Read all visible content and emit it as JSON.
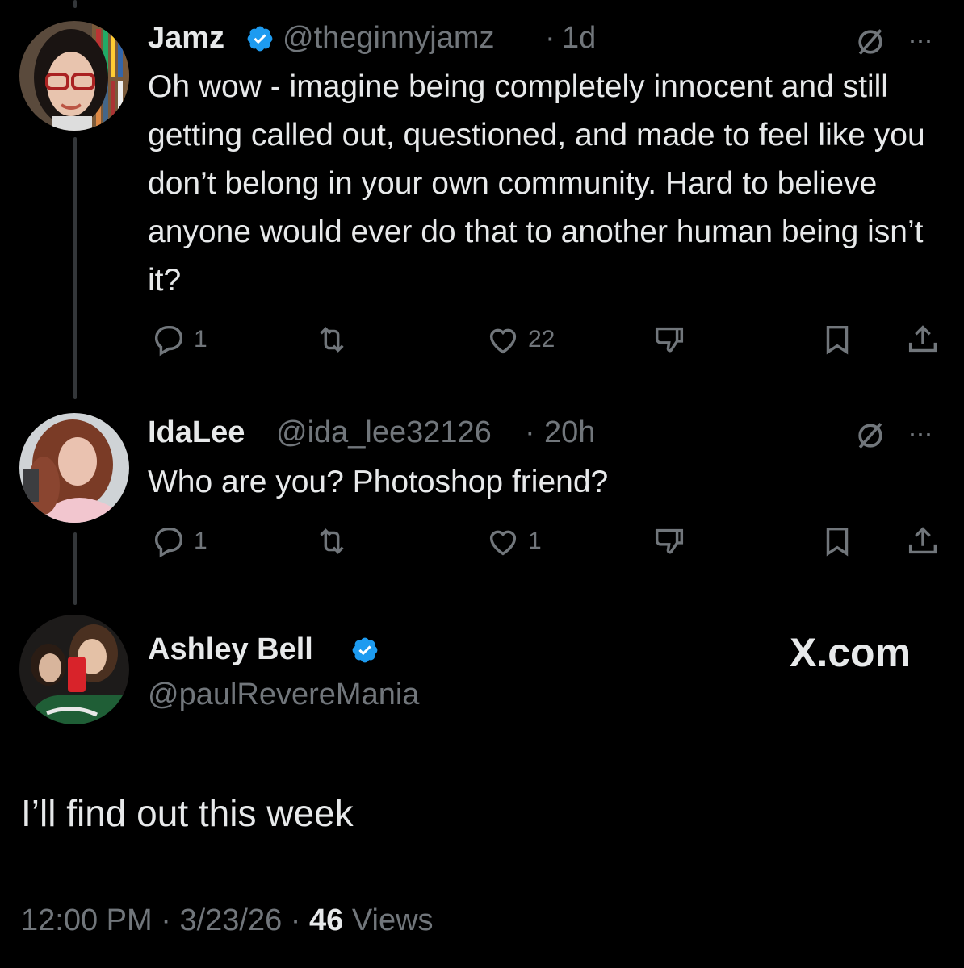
{
  "tweets": [
    {
      "name": "Jamz",
      "handle": "@theginnyjamz",
      "time": "1d",
      "verified": true,
      "text": "Oh wow - imagine being completely innocent and still getting called out, questioned, and made to feel like you don’t belong in your own community. Hard to believe anyone would ever do that to another human being isn’t it?",
      "replies": "1",
      "likes": "22"
    },
    {
      "name": "IdaLee",
      "handle": "@ida_lee32126",
      "time": "20h",
      "verified": false,
      "text": "Who are you? Photoshop friend?",
      "replies": "1",
      "likes": "1"
    }
  ],
  "main_tweet": {
    "name": "Ashley Bell",
    "handle": "@paulRevereMania",
    "verified": true,
    "text": "I’ll find out this week",
    "time": "12:00 PM",
    "date": "3/23/26",
    "views_count": "46",
    "views_label": "Views"
  },
  "watermark": "X.com",
  "separator": "·",
  "more_label": "···",
  "colors": {
    "background": "#000000",
    "text": "#e7e9ea",
    "muted": "#71767b",
    "verified": "#1d9bf0",
    "thread_line": "#333639"
  },
  "icons": [
    "reply-icon",
    "repost-icon",
    "like-icon",
    "downvote-icon",
    "bookmark-icon",
    "share-icon",
    "grok-icon",
    "more-icon",
    "verified-badge-icon"
  ]
}
